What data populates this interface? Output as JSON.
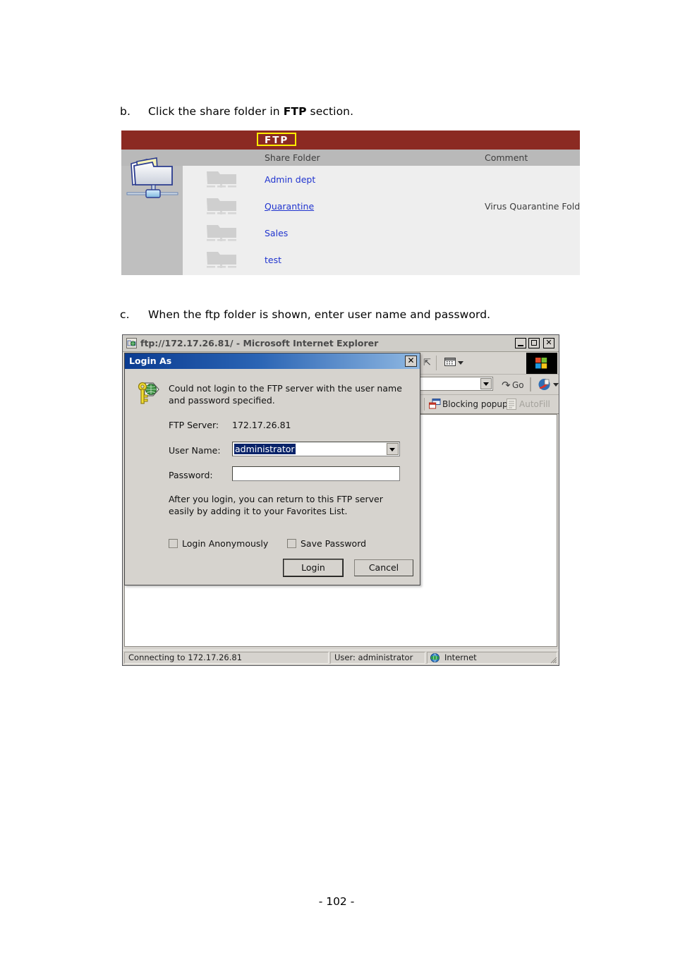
{
  "document": {
    "page_number": "- 102 -",
    "steps": [
      {
        "letter": "b.",
        "text_before": "Click the share folder in ",
        "bold": "FTP",
        "text_after": " section."
      },
      {
        "letter": "c.",
        "text_before": "When the ftp folder is shown, enter user name and password.",
        "bold": "",
        "text_after": ""
      }
    ]
  },
  "ftp_panel": {
    "badge": "FTP",
    "columns": {
      "share_folder": "Share Folder",
      "comment": "Comment"
    },
    "sidebar_icon": "network-share-folder-icon",
    "rows": [
      {
        "icon": "folder-icon",
        "name": "Admin dept",
        "comment": "",
        "underlined": false
      },
      {
        "icon": "folder-icon",
        "name": "Quarantine",
        "comment": "Virus Quarantine Folder",
        "underlined": true
      },
      {
        "icon": "folder-icon",
        "name": "Sales",
        "comment": "",
        "underlined": false
      },
      {
        "icon": "folder-icon",
        "name": "test",
        "comment": "",
        "underlined": false
      }
    ],
    "colors": {
      "title_bar": "#8b2a22",
      "badge_border": "#ffee00",
      "link": "#2034cf",
      "sidebar": "#bfbfbf",
      "body": "#eeeeee"
    }
  },
  "browser": {
    "title": "ftp://172.17.26.81/ - Microsoft Internet Explorer",
    "title_icon": "ftp-folder-icon",
    "window_buttons": {
      "minimize": "minimize-button",
      "maximize": "maximize-button",
      "close": "✕"
    },
    "toolbar": {
      "partial_icon": "refresh-arrow-icon",
      "views_icon": "views-grid-icon",
      "brand_icon": "windows-flag-logo",
      "address_value": "",
      "go_label": "Go",
      "go_icon": "go-arrow-icon",
      "acrobat_icon": "acrobat-toolbar-icon",
      "blocking_popups_label": "Blocking popups",
      "blocking_popups_icon": "popup-blocker-icon",
      "autofill_label": "AutoFill",
      "autofill_icon": "autofill-icon"
    },
    "status_bar": {
      "message": "Connecting to 172.17.26.81",
      "user": "User: administrator",
      "zone": "Internet",
      "zone_icon": "internet-globe-icon"
    }
  },
  "login_dialog": {
    "title": "Login As",
    "close_label": "✕",
    "icon": "key-and-globe-icon",
    "message": "Could not login to the FTP server with the user name and password specified.",
    "fields": {
      "server_label": "FTP Server:",
      "server_value": "172.17.26.81",
      "user_label": "User Name:",
      "user_value": "administrator",
      "password_label": "Password:",
      "password_value": ""
    },
    "hint": "After you login, you can return to this FTP server easily by adding it to your Favorites List.",
    "checkboxes": [
      {
        "label": "Login Anonymously",
        "checked": false
      },
      {
        "label": "Save Password",
        "checked": false
      }
    ],
    "buttons": {
      "login": "Login",
      "cancel": "Cancel"
    }
  }
}
